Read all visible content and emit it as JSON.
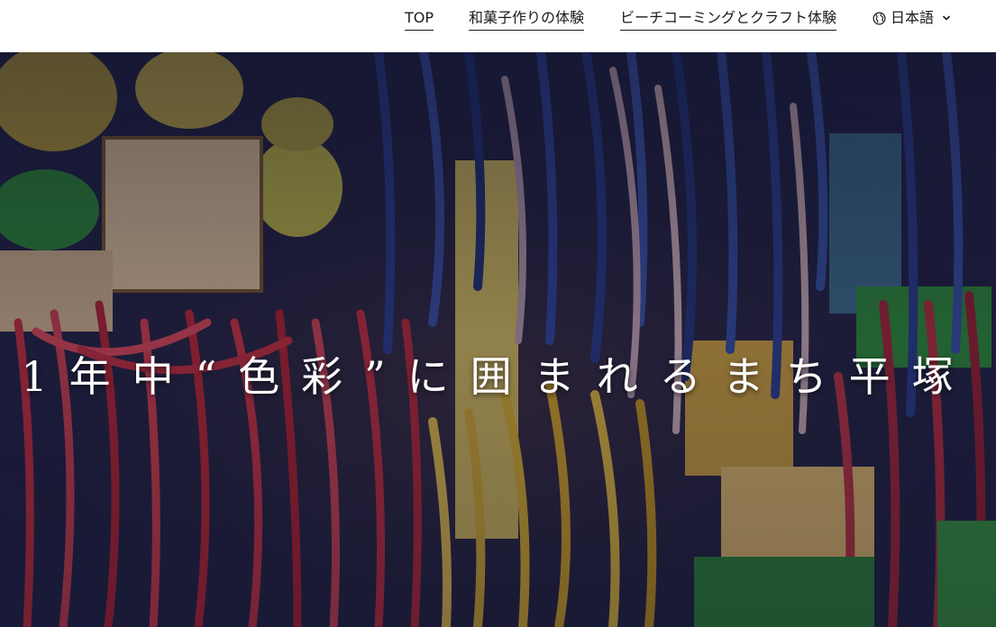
{
  "nav": {
    "top": "TOP",
    "wagashi": "和菓子作りの体験",
    "beach": "ビーチコーミングとクラフト体験"
  },
  "language": {
    "label": "日本語",
    "globe_icon": "globe-icon",
    "chevron_icon": "chevron-down-icon"
  },
  "hero": {
    "title": "1年中“色彩”に囲まれるまち平塚"
  },
  "colors": {
    "header_bg": "#ffffff",
    "text": "#1a1a1a",
    "hero_overlay": "#1b1c3a",
    "streamer_red": "#c8283a",
    "streamer_blue": "#2b3f8f",
    "streamer_yellow": "#e0b530",
    "streamer_green": "#3a9a3a"
  }
}
